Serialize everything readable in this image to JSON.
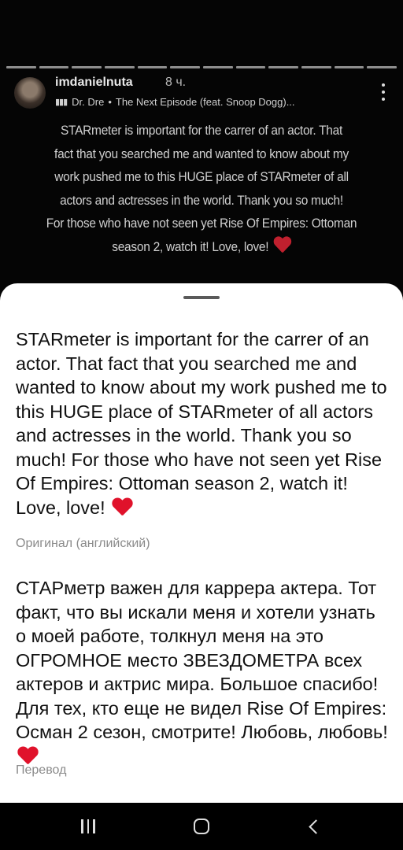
{
  "story": {
    "username": "imdanielnuta",
    "time": "8 ч.",
    "music": {
      "artist": "Dr. Dre",
      "track": "The Next Episode (feat. Snoop Dogg)..."
    },
    "caption_lines": [
      "STARmeter is important for the carrer of an actor. That",
      "fact that you searched me and wanted to know about my",
      "work pushed me to this HUGE place of STARmeter of all",
      "actors and actresses in the world. Thank you so much!",
      "For those who have not seen yet Rise Of Empires: Ottoman",
      "season 2, watch it! Love, love!"
    ]
  },
  "sheet": {
    "original_text": "STARmeter is important for the carrer of an actor. That fact that you searched me and wanted to know about my work pushed me to this HUGE place of STARmeter of all actors and actresses in the world. Thank you so much! For those who have not seen yet Rise Of Empires: Ottoman season 2, watch it! Love, love!",
    "original_label": "Оригинал (английский)",
    "translated_text": "СТАРметр важен для каррера актера. Тот факт, что вы искали меня и хотели узнать о моей работе, толкнул меня на это ОГРОМНОЕ место ЗВЕЗДОМЕТРА всех актеров и актрис мира. Большое спасибо! Для тех, кто еще не видел Rise Of Empires: Осман 2 сезон, смотрите! Любовь, любовь!",
    "translated_label": "Перевод"
  },
  "icons": {
    "heart": "heart-icon",
    "music": "music-bars-icon",
    "more": "more-vertical-icon"
  },
  "colors": {
    "heart": "#e0122b",
    "sheet_bg": "#ffffff",
    "story_bg": "#050505"
  }
}
